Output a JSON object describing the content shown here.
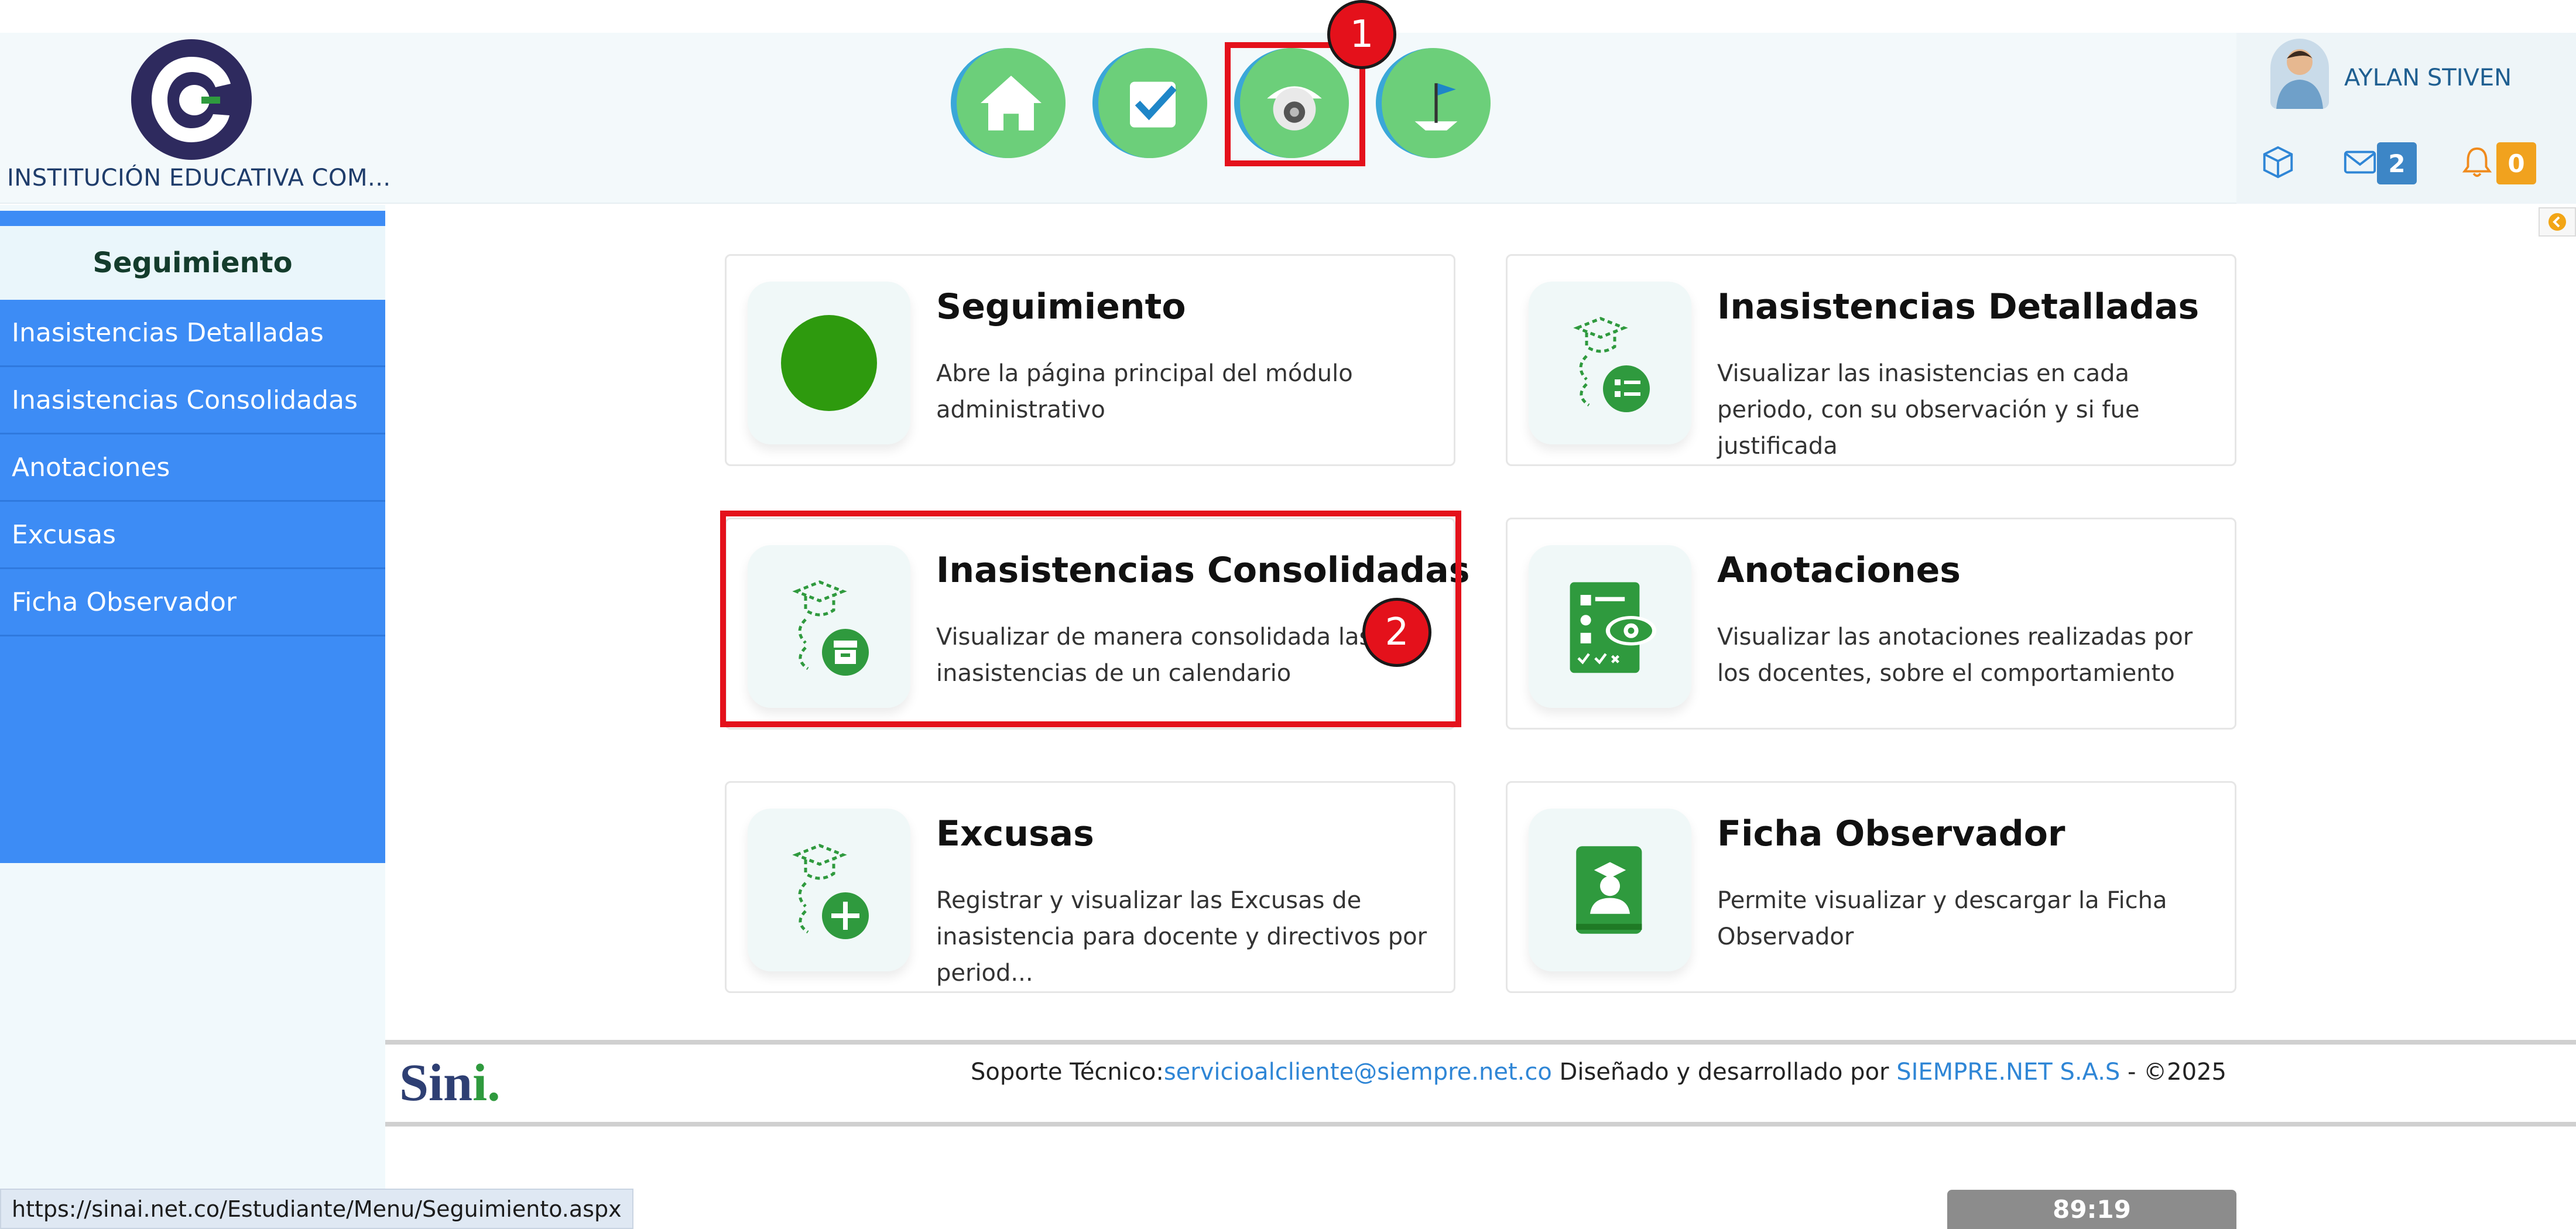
{
  "header": {
    "institution_name": "INSTITUCIÓN EDUCATIVA COM...",
    "nav": [
      {
        "icon": "home-icon"
      },
      {
        "icon": "checkbox-icon"
      },
      {
        "icon": "camera-icon"
      },
      {
        "icon": "flag-icon"
      }
    ],
    "user": {
      "name": "AYLAN STIVEN"
    },
    "messages_count": "2",
    "notifications_count": "0"
  },
  "annotations": {
    "one": "1",
    "two": "2"
  },
  "sidebar": {
    "title": "Seguimiento",
    "items": [
      {
        "label": "Inasistencias Detalladas"
      },
      {
        "label": "Inasistencias Consolidadas"
      },
      {
        "label": "Anotaciones"
      },
      {
        "label": "Excusas"
      },
      {
        "label": "Ficha Observador"
      }
    ]
  },
  "cards": [
    {
      "title": "Seguimiento",
      "desc": "Abre la página principal del módulo administrativo"
    },
    {
      "title": "Inasistencias Detalladas",
      "desc": "Visualizar las inasistencias en cada periodo, con su observación y si fue justificada"
    },
    {
      "title": "Inasistencias Consolidadas",
      "desc": "Visualizar de manera consolidada las inasistencias de un calendario"
    },
    {
      "title": "Anotaciones",
      "desc": "Visualizar las anotaciones realizadas por los docentes, sobre el comportamiento"
    },
    {
      "title": "Excusas",
      "desc": "Registrar y visualizar las Excusas de inasistencia para docente y directivos por period..."
    },
    {
      "title": "Ficha Observador",
      "desc": "Permite visualizar y descargar la Ficha Observador"
    }
  ],
  "footer": {
    "logo_text": "Sin",
    "logo_suffix": "i.",
    "support_label": "Soporte Técnico:",
    "support_email": "servicioalcliente@siempre.net.co",
    "designed_by": " Diseñado y desarrollado por ",
    "company": "SIEMPRE.NET S.A.S",
    "copyright": " -  ©2025"
  },
  "status_url": "https://sinai.net.co/Estudiante/Menu/Seguimiento.aspx",
  "timer": "89:19",
  "colors": {
    "primary_blue": "#3d8cf5",
    "green": "#2f9a3e",
    "annotation_red": "#e4111b"
  }
}
